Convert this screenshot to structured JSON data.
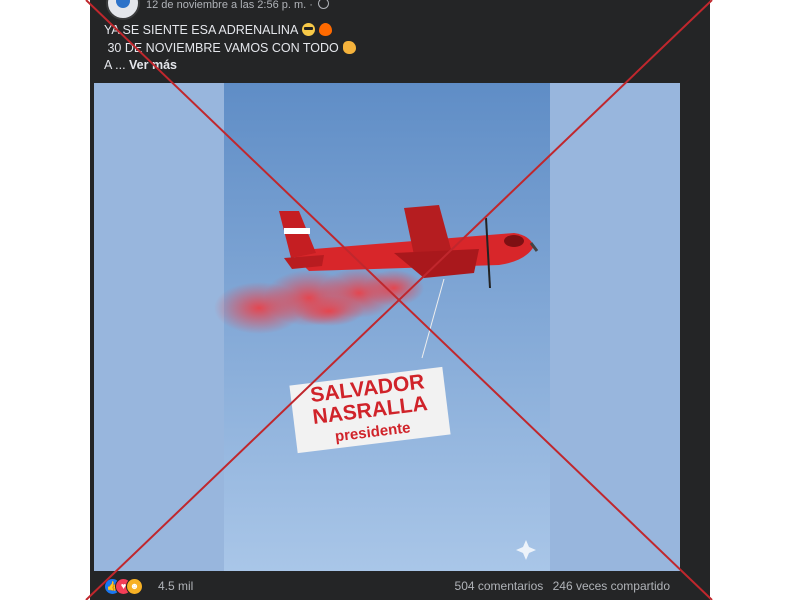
{
  "post": {
    "timestamp": "12 de noviembre a las 2:56 p. m. ·",
    "text_line1": "YA SE SIENTE ESA ADRENALINA",
    "text_line2": " 30 DE NOVIEMBRE VAMOS CON TODO",
    "text_prefix": "A ...",
    "see_more": "Ver más",
    "emojis": [
      "sunglasses-emoji",
      "fire-emoji",
      "flexed-biceps-emoji"
    ]
  },
  "media": {
    "banner_line1": "SALVADOR",
    "banner_line2": "NASRALLA",
    "banner_line3": "presidente"
  },
  "footer": {
    "reaction_icons": [
      "like-icon",
      "love-icon",
      "haha-icon"
    ],
    "reaction_count": "4.5 mil",
    "comments": "504 comentarios",
    "shares": "246 veces compartido"
  },
  "colors": {
    "post_bg": "#242526",
    "text": "#e4e6eb",
    "muted_text": "#b0b3b8",
    "sky": "#98b6dd",
    "plane_red": "#d8262a",
    "cross_red": "#c0272d"
  }
}
